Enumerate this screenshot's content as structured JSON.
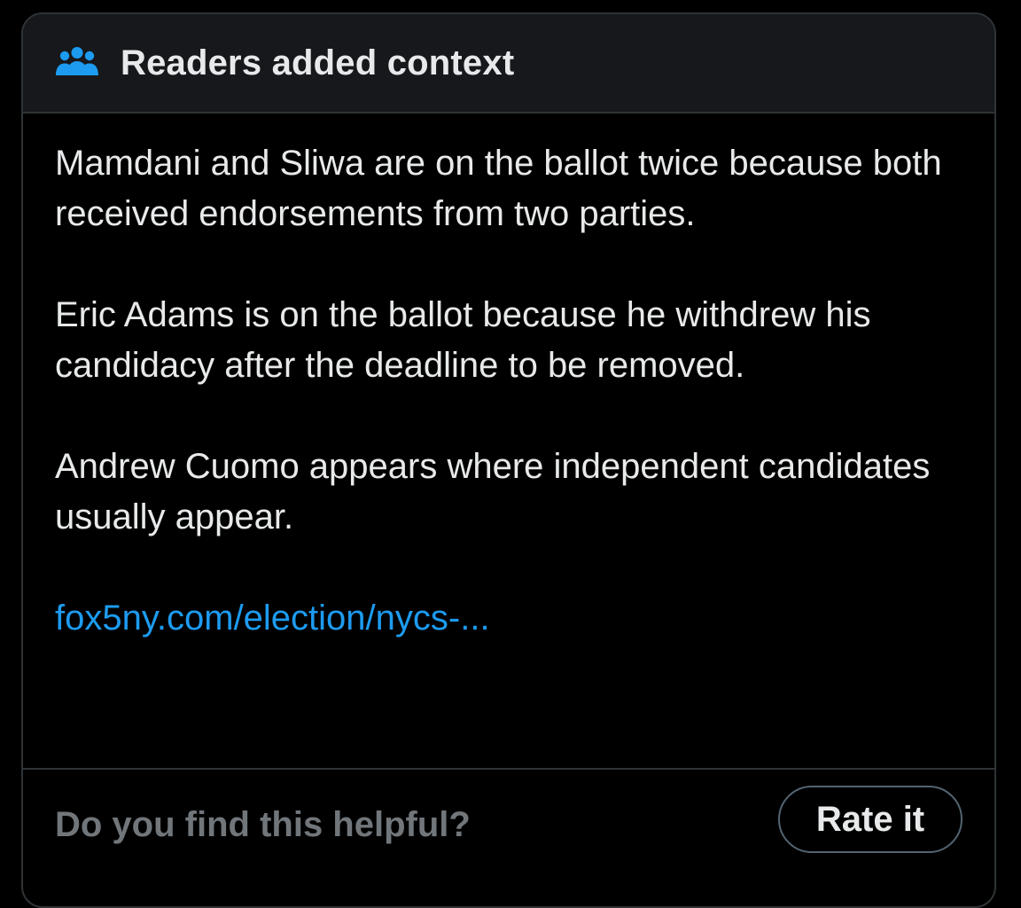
{
  "header": {
    "icon": "people-icon",
    "title": "Readers added context",
    "accent_color": "#1d9bf0"
  },
  "note": {
    "paragraphs": [
      "Mamdani and Sliwa are on the ballot twice because both received endorsements from two parties.",
      "Eric Adams is on the ballot because he withdrew his candidacy after the deadline to be removed.",
      "Andrew Cuomo appears where independent candidates usually appear."
    ],
    "link_text": "fox5ny.com/election/nycs-..."
  },
  "footer": {
    "question": "Do you find this helpful?",
    "rate_button_label": "Rate it"
  }
}
